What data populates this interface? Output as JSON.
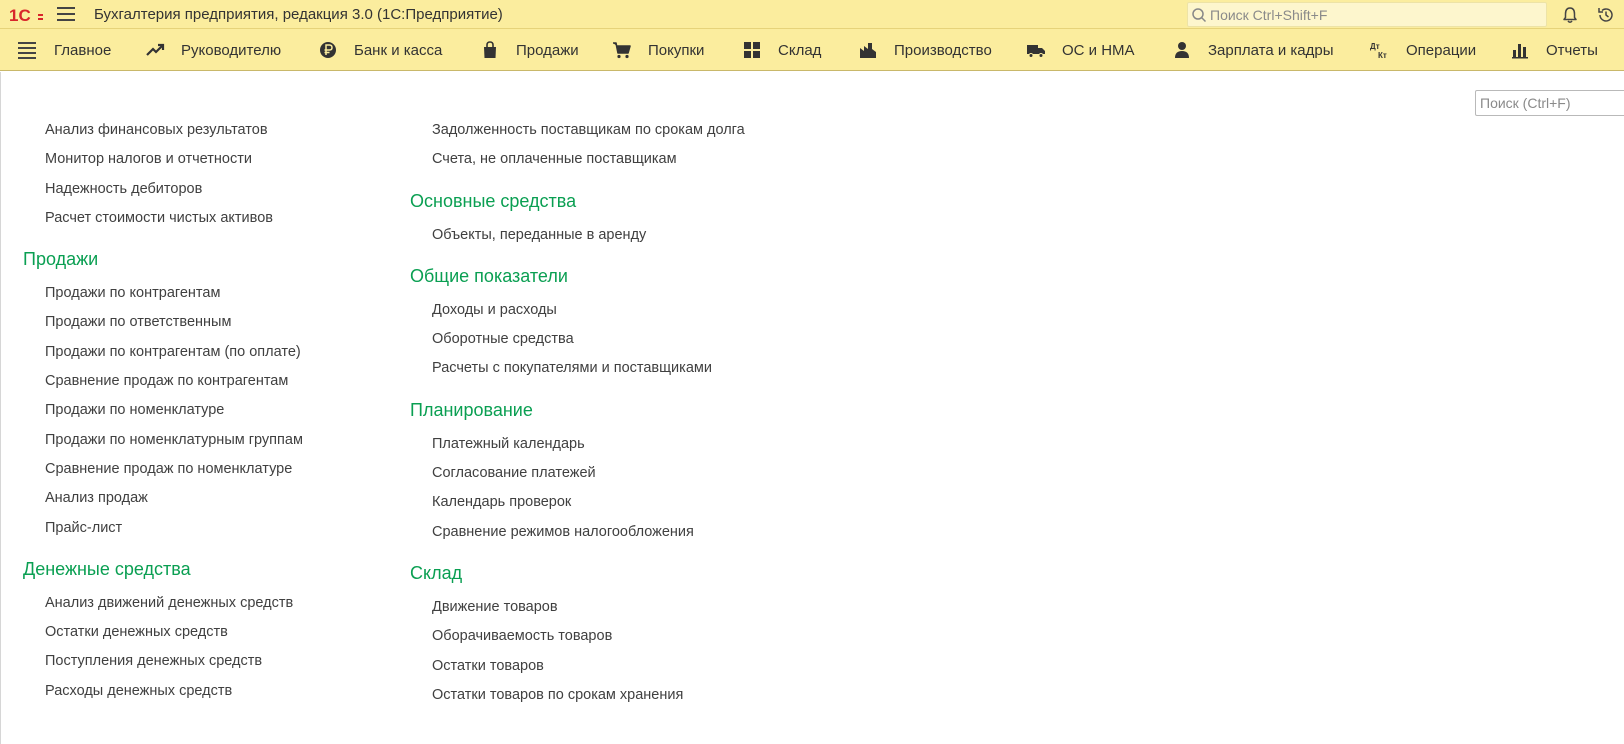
{
  "app": {
    "title": "Бухгалтерия предприятия, редакция 3.0  (1С:Предприятие)",
    "logo_text": "1С",
    "search_placeholder": "Поиск Ctrl+Shift+F"
  },
  "colors": {
    "toolbar_bg": "#fbed9e",
    "group_title": "#0a9f52",
    "link_text": "#404040",
    "logo_red": "#d8262b"
  },
  "sections": [
    {
      "label": "Главное",
      "icon": "menu-lines-icon"
    },
    {
      "label": "Руководителю",
      "icon": "trend-up-icon"
    },
    {
      "label": "Банк и касса",
      "icon": "ruble-coin-icon"
    },
    {
      "label": "Продажи",
      "icon": "shopping-bag-icon"
    },
    {
      "label": "Покупки",
      "icon": "shopping-cart-icon"
    },
    {
      "label": "Склад",
      "icon": "warehouse-grid-icon"
    },
    {
      "label": "Производство",
      "icon": "factory-icon"
    },
    {
      "label": "ОС и НМА",
      "icon": "truck-icon"
    },
    {
      "label": "Зарплата и кадры",
      "icon": "person-icon"
    },
    {
      "label": "Операции",
      "icon": "dt-kt-icon"
    },
    {
      "label": "Отчеты",
      "icon": "bar-chart-icon"
    }
  ],
  "content": {
    "find_placeholder": "Поиск (Ctrl+F)",
    "col1": {
      "top_links": [
        "Анализ финансовых результатов",
        "Монитор налогов и отчетности",
        "Надежность дебиторов",
        "Расчет стоимости чистых активов"
      ],
      "groups": [
        {
          "title": "Продажи",
          "links": [
            "Продажи по контрагентам",
            "Продажи по ответственным",
            "Продажи по контрагентам (по оплате)",
            "Сравнение продаж по контрагентам",
            "Продажи по номенклатуре",
            "Продажи по номенклатурным группам",
            "Сравнение продаж по номенклатуре",
            "Анализ продаж",
            "Прайс-лист"
          ]
        },
        {
          "title": "Денежные средства",
          "links": [
            "Анализ движений денежных средств",
            "Остатки денежных средств",
            "Поступления денежных средств",
            "Расходы денежных средств"
          ]
        }
      ]
    },
    "col2": {
      "top_links": [
        "Задолженность поставщикам по срокам долга",
        "Счета, не оплаченные поставщикам"
      ],
      "groups": [
        {
          "title": "Основные средства",
          "links": [
            "Объекты, переданные в аренду"
          ]
        },
        {
          "title": "Общие показатели",
          "links": [
            "Доходы и расходы",
            "Оборотные средства",
            "Расчеты с покупателями и поставщиками"
          ]
        },
        {
          "title": "Планирование",
          "links": [
            "Платежный календарь",
            "Согласование платежей",
            "Календарь проверок",
            "Сравнение режимов налогообложения"
          ]
        },
        {
          "title": "Склад",
          "links": [
            "Движение товаров",
            "Оборачиваемость товаров",
            "Остатки товаров",
            "Остатки товаров по срокам хранения"
          ]
        }
      ]
    }
  }
}
